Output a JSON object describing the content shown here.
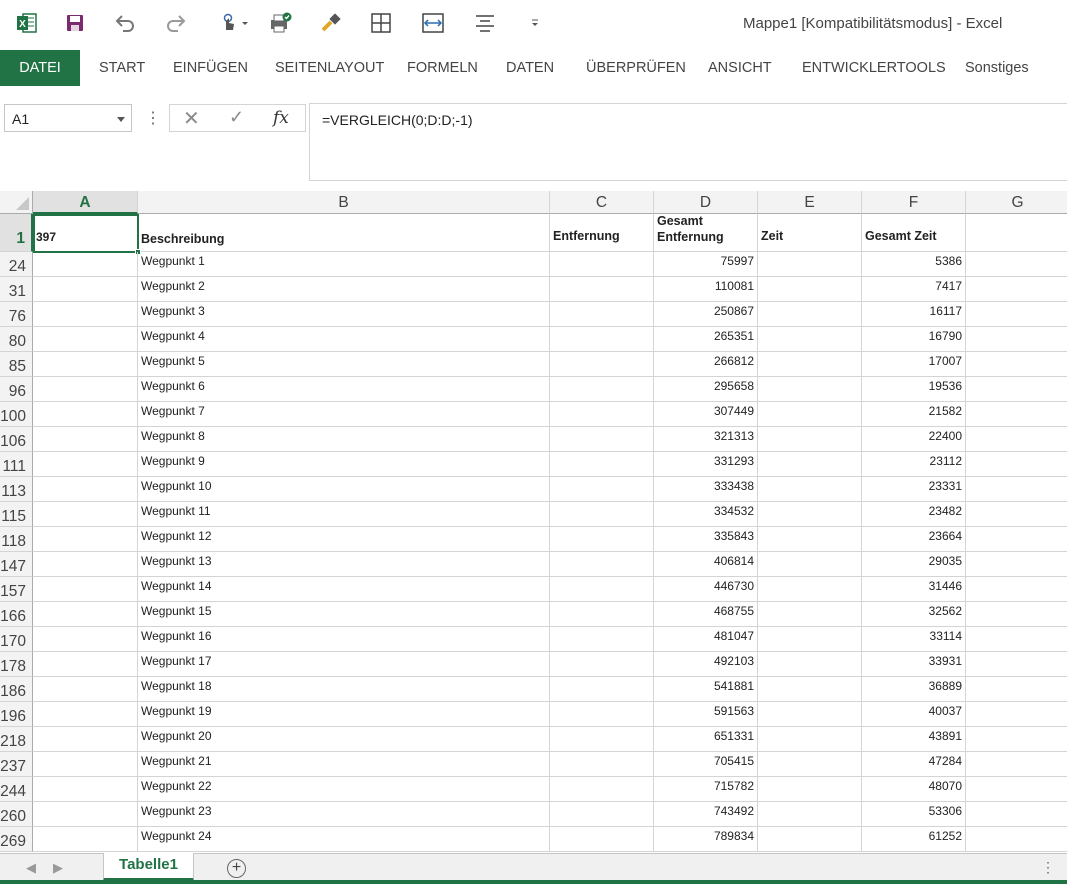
{
  "window": {
    "title": "Mappe1  [Kompatibilitätsmodus] - Excel"
  },
  "quick_access": [
    {
      "icon": "excel-logo-icon"
    },
    {
      "icon": "save-icon"
    },
    {
      "icon": "undo-icon"
    },
    {
      "icon": "redo-icon"
    },
    {
      "icon": "touch-mode-icon"
    },
    {
      "icon": "quick-print-icon"
    },
    {
      "icon": "format-painter-icon"
    },
    {
      "icon": "borders-icon"
    },
    {
      "icon": "column-width-icon"
    },
    {
      "icon": "align-center-icon"
    },
    {
      "icon": "customize-qat-icon"
    }
  ],
  "ribbon": {
    "tabs": [
      "DATEI",
      "START",
      "EINFÜGEN",
      "SEITENLAYOUT",
      "FORMELN",
      "DATEN",
      "ÜBERPRÜFEN",
      "ANSICHT",
      "ENTWICKLERTOOLS",
      "Sonstiges"
    ]
  },
  "formula_bar": {
    "name_box": "A1",
    "formula": "=VERGLEICH(0;D:D;-1)"
  },
  "sheet": {
    "columns": [
      "A",
      "B",
      "C",
      "D",
      "E",
      "F",
      "G"
    ],
    "selected_column": "A",
    "header_row": {
      "row_number": "1",
      "a": "397",
      "b": "Beschreibung",
      "c": "Entfernung",
      "d_line1": "Gesamt",
      "d_line2": "Entfernung",
      "e": "Zeit",
      "f": "Gesamt Zeit"
    },
    "rows": [
      {
        "row": "24",
        "b": "Wegpunkt 1",
        "d": "75997",
        "f": "5386"
      },
      {
        "row": "31",
        "b": "Wegpunkt 2",
        "d": "110081",
        "f": "7417"
      },
      {
        "row": "76",
        "b": "Wegpunkt 3",
        "d": "250867",
        "f": "16117"
      },
      {
        "row": "80",
        "b": "Wegpunkt 4",
        "d": "265351",
        "f": "16790"
      },
      {
        "row": "85",
        "b": "Wegpunkt 5",
        "d": "266812",
        "f": "17007"
      },
      {
        "row": "96",
        "b": "Wegpunkt 6",
        "d": "295658",
        "f": "19536"
      },
      {
        "row": "100",
        "b": "Wegpunkt 7",
        "d": "307449",
        "f": "21582"
      },
      {
        "row": "106",
        "b": "Wegpunkt 8",
        "d": "321313",
        "f": "22400"
      },
      {
        "row": "111",
        "b": "Wegpunkt 9",
        "d": "331293",
        "f": "23112"
      },
      {
        "row": "113",
        "b": "Wegpunkt 10",
        "d": "333438",
        "f": "23331"
      },
      {
        "row": "115",
        "b": "Wegpunkt 11",
        "d": "334532",
        "f": "23482"
      },
      {
        "row": "118",
        "b": "Wegpunkt 12",
        "d": "335843",
        "f": "23664"
      },
      {
        "row": "147",
        "b": "Wegpunkt 13",
        "d": "406814",
        "f": "29035"
      },
      {
        "row": "157",
        "b": "Wegpunkt 14",
        "d": "446730",
        "f": "31446"
      },
      {
        "row": "166",
        "b": "Wegpunkt 15",
        "d": "468755",
        "f": "32562"
      },
      {
        "row": "170",
        "b": "Wegpunkt 16",
        "d": "481047",
        "f": "33114"
      },
      {
        "row": "178",
        "b": "Wegpunkt 17",
        "d": "492103",
        "f": "33931"
      },
      {
        "row": "186",
        "b": "Wegpunkt 18",
        "d": "541881",
        "f": "36889"
      },
      {
        "row": "196",
        "b": "Wegpunkt 19",
        "d": "591563",
        "f": "40037"
      },
      {
        "row": "218",
        "b": "Wegpunkt 20",
        "d": "651331",
        "f": "43891"
      },
      {
        "row": "237",
        "b": "Wegpunkt 21",
        "d": "705415",
        "f": "47284"
      },
      {
        "row": "244",
        "b": "Wegpunkt 22",
        "d": "715782",
        "f": "48070"
      },
      {
        "row": "260",
        "b": "Wegpunkt 23",
        "d": "743492",
        "f": "53306"
      },
      {
        "row": "269",
        "b": "Wegpunkt 24",
        "d": "789834",
        "f": "61252"
      }
    ]
  },
  "sheet_tabs": {
    "active": "Tabelle1",
    "add_label": "+"
  },
  "colors": {
    "excel_green": "#217346",
    "grid_line": "#d4d4d4",
    "header_bg": "#f3f3f3"
  }
}
